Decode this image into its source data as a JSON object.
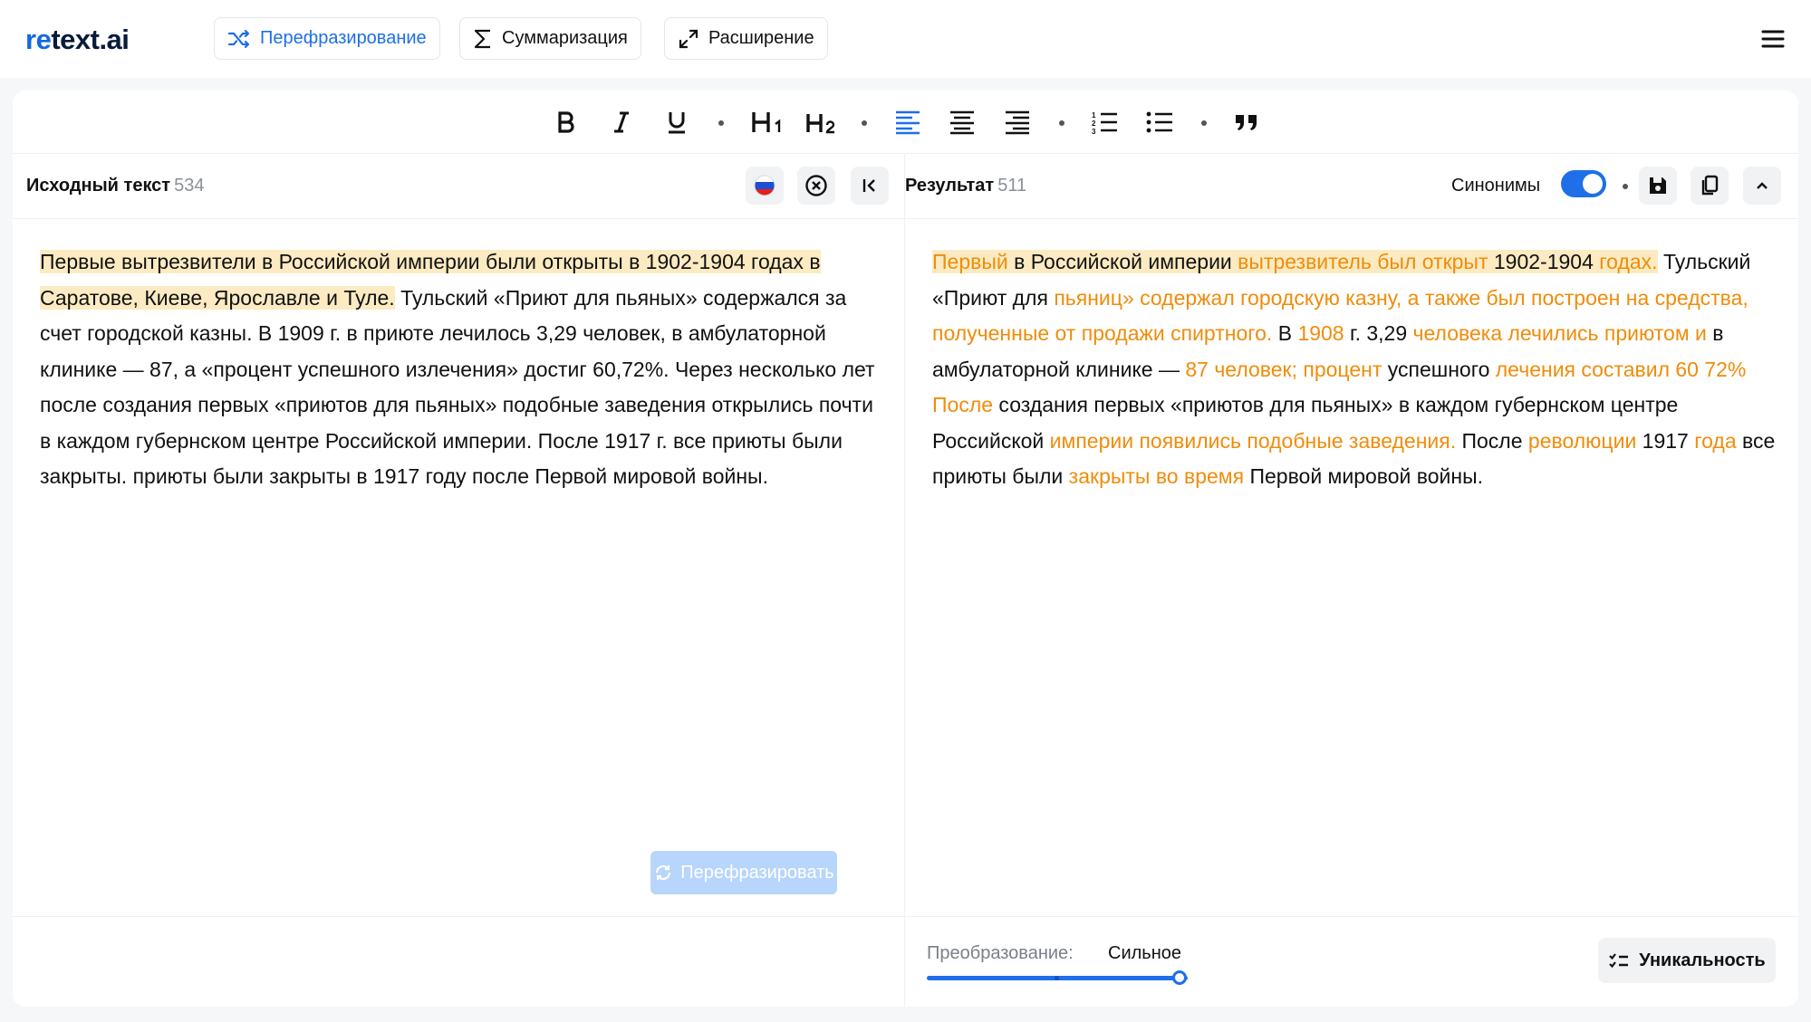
{
  "app": {
    "logo_prefix": "re",
    "logo_rest": "text.ai"
  },
  "nav": {
    "tabs": [
      {
        "label": "Перефразирование",
        "active": true,
        "icon": "shuffle-icon"
      },
      {
        "label": "Суммаризация",
        "active": false,
        "icon": "sigma-icon"
      },
      {
        "label": "Расширение",
        "active": false,
        "icon": "expand-icon"
      }
    ],
    "menu_icon": "hamburger-icon"
  },
  "toolbar": {
    "buttons": [
      "bold",
      "italic",
      "underline",
      "heading-1",
      "heading-2",
      "align-left",
      "align-center",
      "align-right",
      "ordered-list",
      "bullet-list",
      "quote"
    ],
    "active": "align-left"
  },
  "source": {
    "title": "Исходный текст",
    "count": "534",
    "segments": [
      {
        "text": "Первые вытрезвители в Российской империи были открыты в 1902-1904 годах в Саратове, Киеве, Ярославле и Туле.",
        "highlight": true
      },
      {
        "text": " Тульский «Приют для пьяных» содержался за счет городской казны. В 1909 г. в приюте лечилось 3,29 человек, в амбулаторной клинике — 87, а «процент успешного излечения» достиг 60,72%. Через несколько лет после создания первых «приютов для пьяных» подобные заведения открылись почти в каждом губернском центре Российской империи. После 1917 г. все приюты были закрыты. приюты были закрыты в 1917 году после Первой мировой войны.",
        "highlight": false
      }
    ],
    "rephrase_button": "Перефразировать"
  },
  "result": {
    "title": "Результат",
    "count": "511",
    "synonyms_label": "Синонимы",
    "synonyms_on": true,
    "segments": [
      {
        "text": "Первый",
        "changed": true,
        "highlight": true
      },
      {
        "text": " в Российской империи ",
        "changed": false,
        "highlight": true
      },
      {
        "text": "вытрезвитель был открыт",
        "changed": true,
        "highlight": true
      },
      {
        "text": " 1902-1904 ",
        "changed": false,
        "highlight": true
      },
      {
        "text": "годах.",
        "changed": true,
        "highlight": true
      },
      {
        "text": " Тульский «Приют для ",
        "changed": false,
        "highlight": false
      },
      {
        "text": "пьяниц» содержал городскую казну, а также был построен на средства, полученные от продажи спиртного.",
        "changed": true,
        "highlight": false
      },
      {
        "text": " В ",
        "changed": false,
        "highlight": false
      },
      {
        "text": "1908",
        "changed": true,
        "highlight": false
      },
      {
        "text": " г. 3,29 ",
        "changed": false,
        "highlight": false
      },
      {
        "text": "человека лечились приютом и",
        "changed": true,
        "highlight": false
      },
      {
        "text": " в амбулаторной клинике — ",
        "changed": false,
        "highlight": false
      },
      {
        "text": "87 человек; процент",
        "changed": true,
        "highlight": false
      },
      {
        "text": " успешного ",
        "changed": false,
        "highlight": false
      },
      {
        "text": "лечения составил 60 72% После",
        "changed": true,
        "highlight": false
      },
      {
        "text": " создания первых «приютов для пьяных» в каждом губернском центре Российской ",
        "changed": false,
        "highlight": false
      },
      {
        "text": "империи появились подобные заведения.",
        "changed": true,
        "highlight": false
      },
      {
        "text": " После ",
        "changed": false,
        "highlight": false
      },
      {
        "text": "революции",
        "changed": true,
        "highlight": false
      },
      {
        "text": " 1917 ",
        "changed": false,
        "highlight": false
      },
      {
        "text": "года",
        "changed": true,
        "highlight": false
      },
      {
        "text": " все приюты были ",
        "changed": false,
        "highlight": false
      },
      {
        "text": "закрыты во время",
        "changed": true,
        "highlight": false
      },
      {
        "text": " Первой мировой войны.",
        "changed": false,
        "highlight": false
      }
    ],
    "transform_label": "Преобразование:",
    "transform_value": "Сильное",
    "transform_level": 1.0,
    "uniqueness_button": "Уникальность"
  },
  "colors": {
    "accent": "#1e6fe8",
    "changed_text": "#f08c0a",
    "highlight": "#fcebc2"
  }
}
